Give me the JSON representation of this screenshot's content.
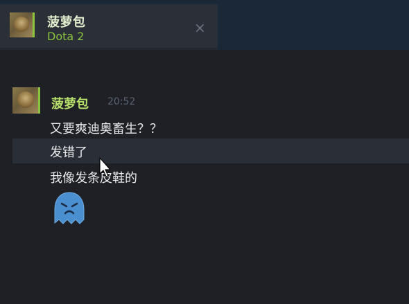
{
  "tab": {
    "name": "菠萝包",
    "game": "Dota 2",
    "close_glyph": "×"
  },
  "chat": {
    "sender": "菠萝包",
    "timestamp": "20:52",
    "messages": [
      "又要爽迪奥畜生？？",
      "发错了",
      "我像发条皮鞋的"
    ],
    "sticker": "sad-blue-ghost-sticker"
  },
  "colors": {
    "accent_green": "#8bc53f",
    "name_green": "#b7e06a",
    "background": "#1e2026",
    "tab_background": "#2b2f38",
    "hover_row": "#2a2e36"
  }
}
